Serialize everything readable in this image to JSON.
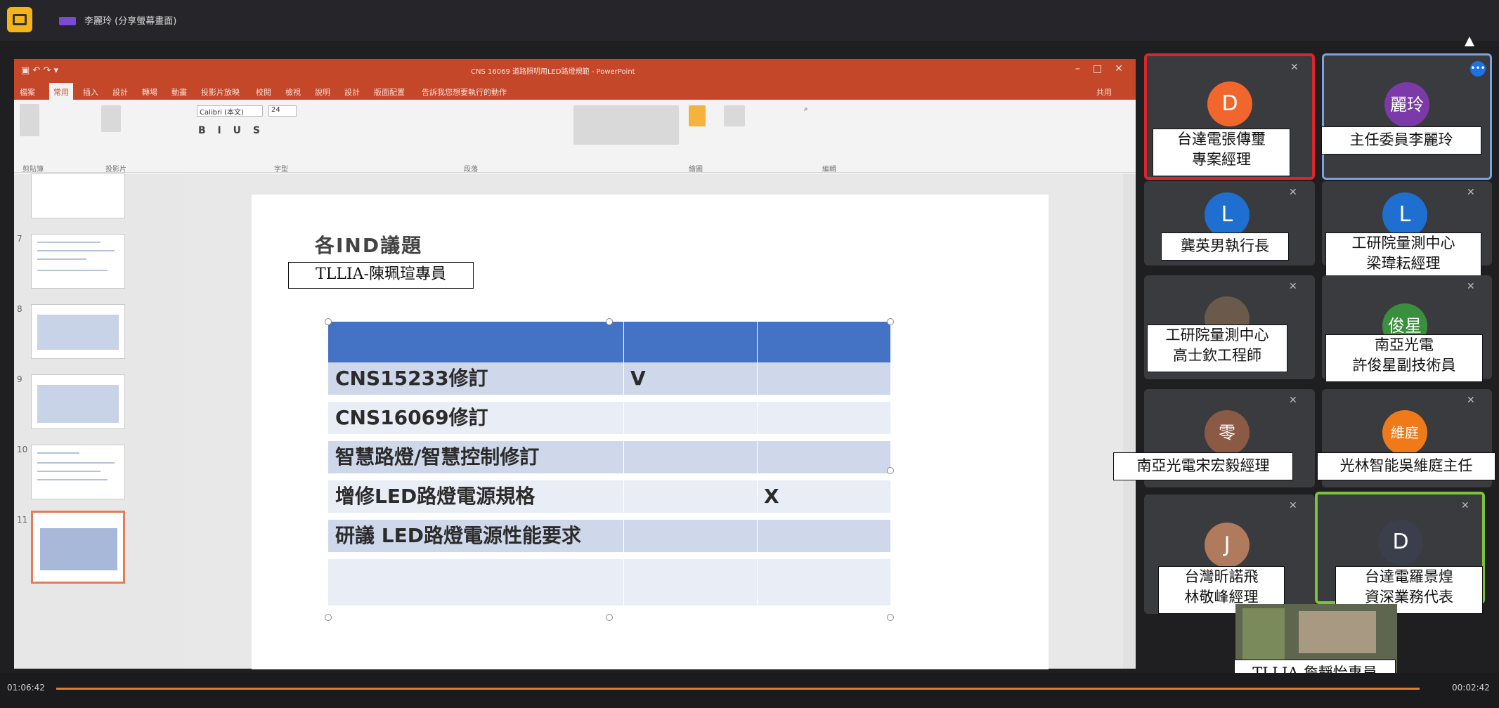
{
  "meeting": {
    "presenter": "李麗玲 (分享螢幕畫面)"
  },
  "ppt": {
    "title": "CNS 16069 道路照明用LED路燈規範 - PowerPoint",
    "ribbon_font": "Calibri (本文)",
    "ribbon_size": "24",
    "tell_me": "告訴我您想要執行的動作",
    "share": "共用",
    "tabs": [
      "檔案",
      "常用",
      "插入",
      "設計",
      "轉場",
      "動畫",
      "投影片放映",
      "校閱",
      "檢視",
      "說明",
      "設計",
      "版面配置"
    ],
    "group_labels": [
      "剪貼簿",
      "投影片",
      "字型",
      "段落",
      "繪圖",
      "編輯"
    ],
    "slide_numbers": [
      "7",
      "8",
      "9",
      "10",
      "11"
    ],
    "slide_heading": "各IND議題"
  },
  "slide_table": {
    "rows": [
      {
        "item": "CNS15233修訂",
        "c1": "V",
        "c2": ""
      },
      {
        "item": "CNS16069修訂",
        "c1": "",
        "c2": ""
      },
      {
        "item": "智慧路燈/智慧控制修訂",
        "c1": "",
        "c2": ""
      },
      {
        "item": "增修LED路燈電源規格",
        "c1": "",
        "c2": "X"
      },
      {
        "item": "研議 LED路燈電源性能要求",
        "c1": "",
        "c2": ""
      },
      {
        "item": "",
        "c1": "",
        "c2": ""
      }
    ]
  },
  "labels": {
    "presenter_overlay": "TLLIA-陳珮瑄專員",
    "bottom_overlay": "TLLIA-詹靜怡專員"
  },
  "participants": [
    {
      "initial": "D",
      "color": "#f0662d",
      "lines": [
        "台達電張傳璽",
        "專案經理"
      ],
      "highlight": "#d8262c"
    },
    {
      "initial": "麗玲",
      "color": "#7b3aa8",
      "lines": [
        "主任委員李麗玲"
      ],
      "highlight": "#7fa0de"
    },
    {
      "initial": "L",
      "color": "#1f6fd1",
      "lines": [
        "龔英男執行長"
      ],
      "highlight": ""
    },
    {
      "initial": "L",
      "color": "#1f6fd1",
      "lines": [
        "工研院量測中心",
        "梁瑋耘經理"
      ],
      "highlight": ""
    },
    {
      "initial": "",
      "color": "#6b5a4c",
      "lines": [
        "工研院量測中心",
        "高士欽工程師"
      ],
      "highlight": ""
    },
    {
      "initial": "俊星",
      "color": "#3a8f3c",
      "lines": [
        "南亞光電",
        "許俊星副技術員"
      ],
      "highlight": ""
    },
    {
      "initial": "零",
      "color": "#8b5a45",
      "lines": [
        "南亞光電宋宏毅經理"
      ],
      "highlight": ""
    },
    {
      "initial": "維庭",
      "color": "#f07a1a",
      "lines": [
        "光林智能吳維庭主任"
      ],
      "highlight": ""
    },
    {
      "initial": "J",
      "color": "#b07a5c",
      "lines": [
        "台灣昕諾飛",
        "林敬峰經理"
      ],
      "highlight": ""
    },
    {
      "initial": "D",
      "color": "#3a3f4b",
      "lines": [
        "台達電羅景煌",
        "資深業務代表"
      ],
      "highlight": "#79c43b"
    }
  ],
  "playback": {
    "elapsed": "01:06:42",
    "remaining": "00:02:42"
  },
  "colors": {
    "ppt_accent": "#c4472a",
    "table_header": "#4472c4",
    "table_odd": "#cfd8ea",
    "table_even": "#e9edf5"
  }
}
